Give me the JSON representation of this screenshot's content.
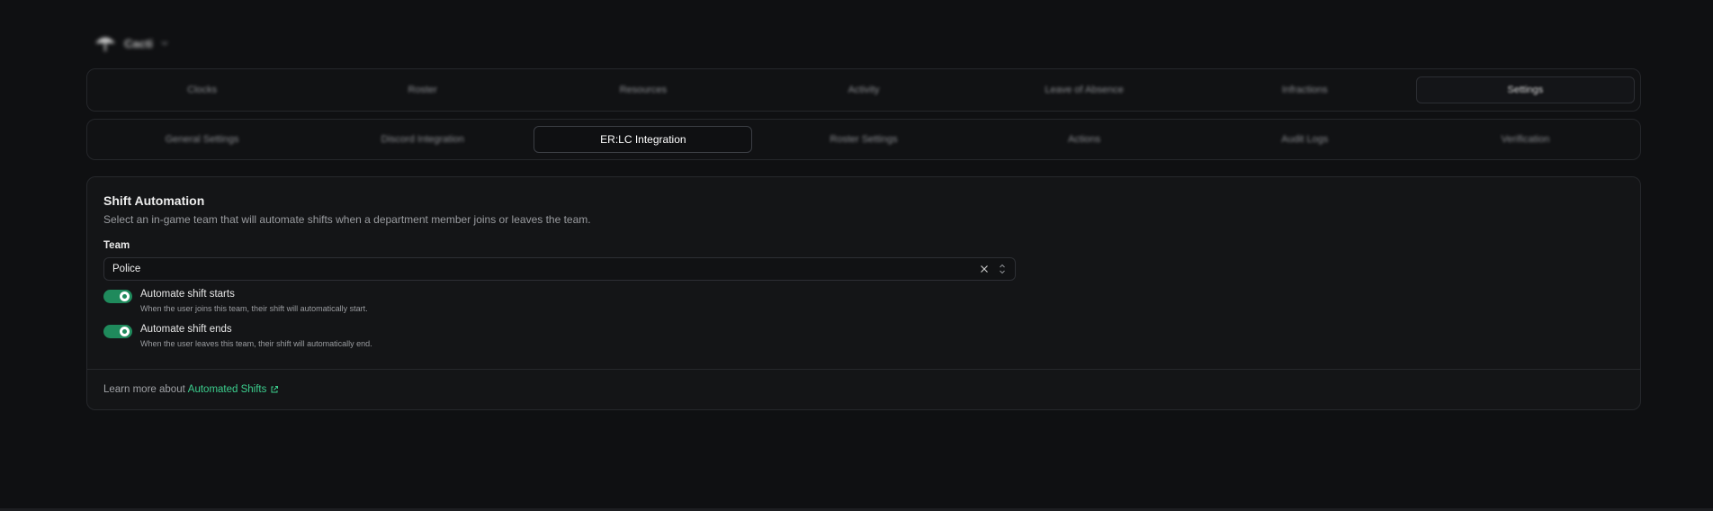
{
  "workspace": {
    "name": "Cacti"
  },
  "main_nav": {
    "tabs": [
      {
        "label": "Clocks"
      },
      {
        "label": "Roster"
      },
      {
        "label": "Resources"
      },
      {
        "label": "Activity"
      },
      {
        "label": "Leave of Absence"
      },
      {
        "label": "Infractions"
      },
      {
        "label": "Settings"
      }
    ],
    "active": "Settings"
  },
  "settings_nav": {
    "tabs": [
      {
        "label": "General Settings"
      },
      {
        "label": "Discord Integration"
      },
      {
        "label": "ER:LC Integration"
      },
      {
        "label": "Roster Settings"
      },
      {
        "label": "Actions"
      },
      {
        "label": "Audit Logs"
      },
      {
        "label": "Verification"
      }
    ],
    "active": "ER:LC Integration"
  },
  "card": {
    "title": "Shift Automation",
    "description": "Select an in-game team that will automate shifts when a department member joins or leaves the team.",
    "team_field": {
      "label": "Team",
      "value": "Police"
    },
    "toggles": [
      {
        "label": "Automate shift starts",
        "help": "When the user joins this team, their shift will automatically start.",
        "checked": true
      },
      {
        "label": "Automate shift ends",
        "help": "When the user leaves this team, their shift will automatically end.",
        "checked": true
      }
    ],
    "footer": {
      "text": "Learn more about",
      "link_text": "Automated Shifts"
    }
  },
  "colors": {
    "background": "#0f1012",
    "accent": "#1f8a5c",
    "link": "#3ccf8e"
  },
  "icons": {
    "workspace_logo": "umbrella-icon",
    "clear": "close-icon",
    "select": "chevron-up-down-icon",
    "external": "external-link-icon"
  }
}
